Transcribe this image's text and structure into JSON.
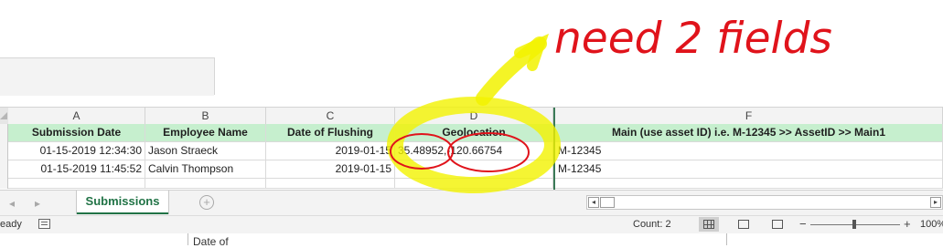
{
  "grid": {
    "column_letters": [
      "A",
      "B",
      "C",
      "D",
      "F"
    ],
    "header_cells": [
      "Submission Date",
      "Employee Name",
      "Date of Flushing",
      "Geolocation",
      "Main (use asset ID) i.e. M-12345 >> AssetID >> Main1"
    ],
    "rows": [
      {
        "submission_date": "01-15-2019 12:34:30",
        "employee": "Jason Straeck",
        "flushing_date": "2019-01-15",
        "geo_lat": "35.48952,",
        "geo_lon": "-120.66754",
        "main": "M-12345"
      },
      {
        "submission_date": "01-15-2019 11:45:52",
        "employee": "Calvin Thompson",
        "flushing_date": "2019-01-15",
        "geo_lat": "",
        "geo_lon": "",
        "main": "M-12345"
      }
    ],
    "header_fill_color": "#c6efce"
  },
  "sheet_tabs": {
    "nav_prev": "◂",
    "nav_next": "▸",
    "active_tab": "Submissions",
    "add_sheet": "+"
  },
  "status_bar": {
    "mode": "eady",
    "count": "Count: 2",
    "zoom_minus": "−",
    "zoom_plus": "+",
    "zoom": "100%"
  },
  "below_window": {
    "text": "Date of"
  },
  "annotation": {
    "text": "need 2 fields",
    "ink_color": "#e0131b",
    "highlight_color": "#f2f200"
  }
}
